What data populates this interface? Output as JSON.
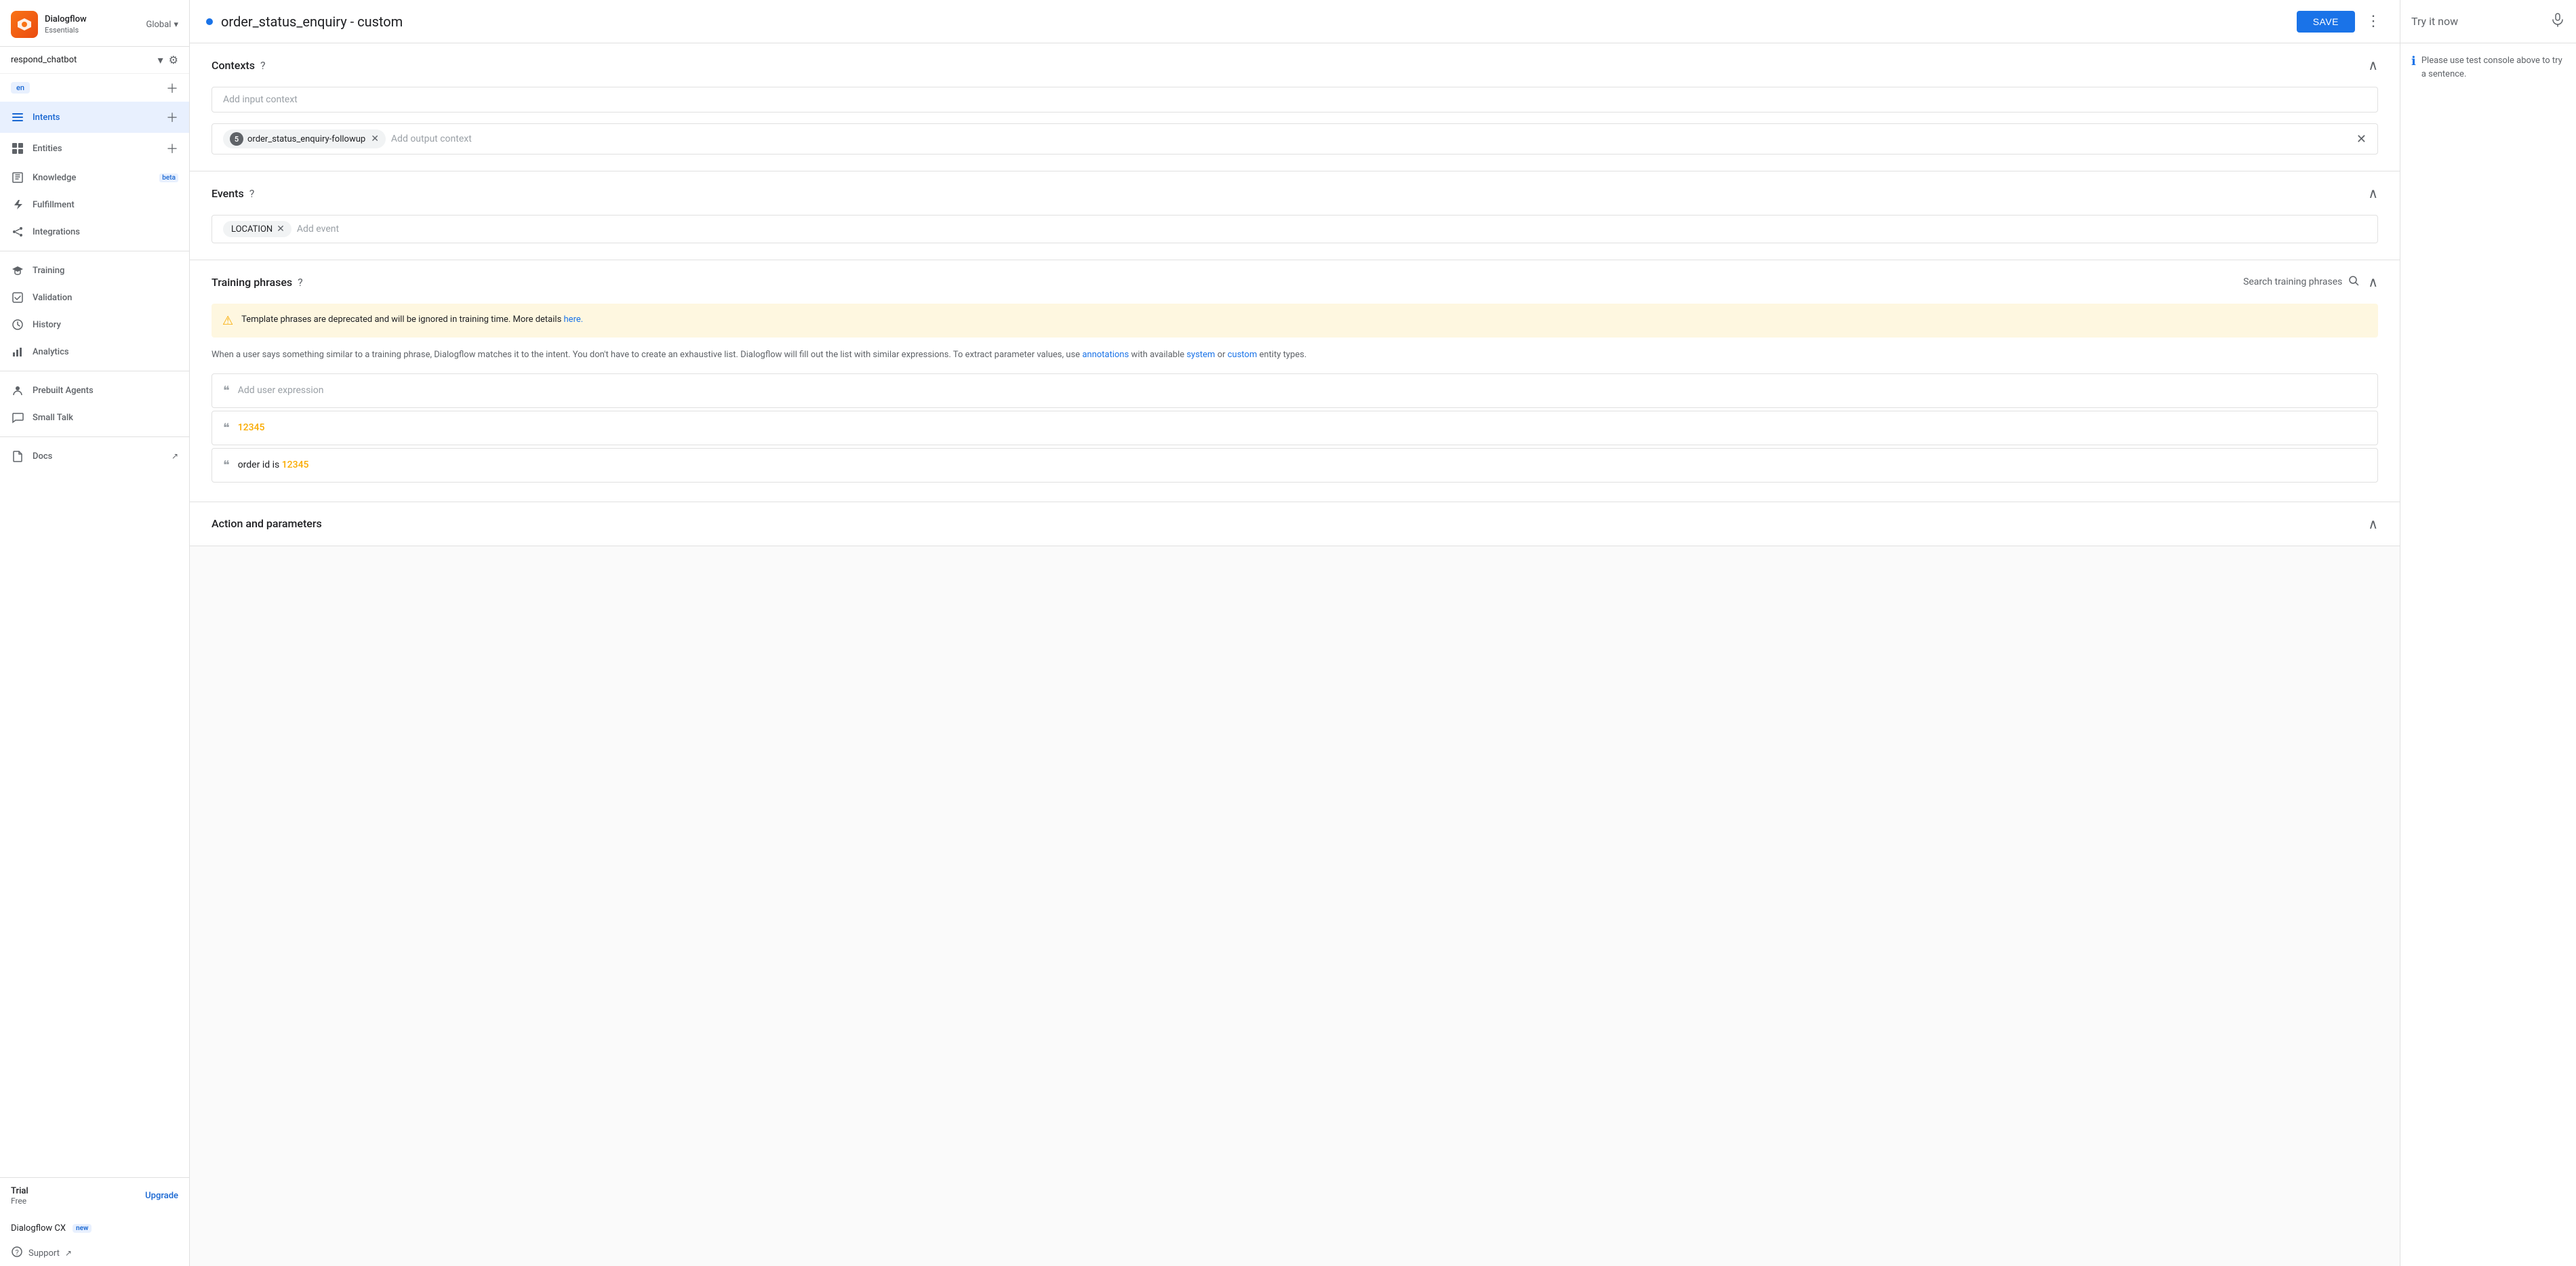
{
  "app": {
    "logo_initial": "D",
    "logo_title": "Dialogflow",
    "logo_subtitle": "Essentials",
    "global_label": "Global"
  },
  "sidebar": {
    "agent_name": "respond_chatbot",
    "language_badge": "en",
    "nav_items": [
      {
        "id": "intents",
        "label": "Intents",
        "active": true,
        "has_add": true,
        "icon": "list-icon"
      },
      {
        "id": "entities",
        "label": "Entities",
        "active": false,
        "has_add": true,
        "icon": "grid-icon"
      },
      {
        "id": "knowledge",
        "label": "Knowledge",
        "active": false,
        "badge": "beta",
        "icon": "book-icon"
      },
      {
        "id": "fulfillment",
        "label": "Fulfillment",
        "active": false,
        "icon": "bolt-icon"
      },
      {
        "id": "integrations",
        "label": "Integrations",
        "active": false,
        "icon": "share-icon"
      },
      {
        "id": "training",
        "label": "Training",
        "active": false,
        "icon": "grad-icon"
      },
      {
        "id": "validation",
        "label": "Validation",
        "active": false,
        "icon": "check-icon"
      },
      {
        "id": "history",
        "label": "History",
        "active": false,
        "icon": "clock-icon"
      },
      {
        "id": "analytics",
        "label": "Analytics",
        "active": false,
        "icon": "bar-icon"
      },
      {
        "id": "prebuilt",
        "label": "Prebuilt Agents",
        "active": false,
        "icon": "person-icon"
      },
      {
        "id": "smalltalk",
        "label": "Small Talk",
        "active": false,
        "icon": "chat-icon"
      },
      {
        "id": "docs",
        "label": "Docs",
        "active": false,
        "icon": "doc-icon",
        "external": true
      }
    ],
    "trial_label": "Trial",
    "trial_plan": "Free",
    "upgrade_label": "Upgrade",
    "dialogflow_cx_label": "Dialogflow CX",
    "new_badge": "new",
    "support_label": "Support"
  },
  "topbar": {
    "intent_name": "order_status_enquiry - custom",
    "save_label": "SAVE"
  },
  "contexts": {
    "section_title": "Contexts",
    "input_placeholder": "Add input context",
    "output_context_num": "5",
    "output_context_name": "order_status_enquiry-followup",
    "output_context_placeholder": "Add output context"
  },
  "events": {
    "section_title": "Events",
    "event_name": "LOCATION",
    "add_event_placeholder": "Add event"
  },
  "training_phrases": {
    "section_title": "Training phrases",
    "search_label": "Search training phrases",
    "warning_text": "Template phrases are deprecated and will be ignored in training time. More details ",
    "warning_link_text": "here.",
    "description": "When a user says something similar to a training phrase, Dialogflow matches it to the intent. You don't have to create an exhaustive list. Dialogflow will fill out the list with similar expressions. To extract parameter values, use ",
    "desc_link1": "annotations",
    "desc_mid": " with available ",
    "desc_link2": "system",
    "desc_or": " or ",
    "desc_link3": "custom",
    "desc_end": " entity types.",
    "add_expression_placeholder": "Add user expression",
    "phrases": [
      {
        "id": 1,
        "parts": [
          {
            "text": "12345",
            "highlight": true
          }
        ]
      },
      {
        "id": 2,
        "parts": [
          {
            "text": "order id is ",
            "highlight": false
          },
          {
            "text": "12345",
            "highlight": true
          }
        ]
      }
    ]
  },
  "action_section": {
    "section_title": "Action and parameters"
  },
  "right_panel": {
    "try_it_label": "Try it now",
    "info_text": "Please use test console above to try a sentence."
  }
}
